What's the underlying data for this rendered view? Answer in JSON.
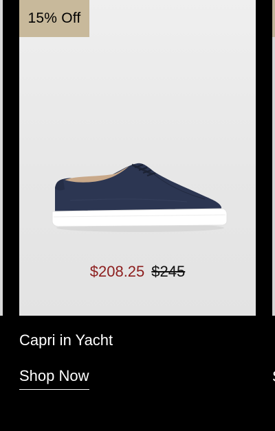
{
  "product": {
    "badge": "15% Off",
    "name": "Capri in Yacht",
    "sale_price": "$208.25",
    "original_price": "$245",
    "cta_label": "Shop Now",
    "image_name": "navy-suede-sneaker"
  },
  "colors": {
    "background": "#000000",
    "badge_bg": "#c8b99b",
    "sale_price": "#8c1d1d",
    "shoe_upper": "#2b3550",
    "sole": "#ffffff"
  }
}
